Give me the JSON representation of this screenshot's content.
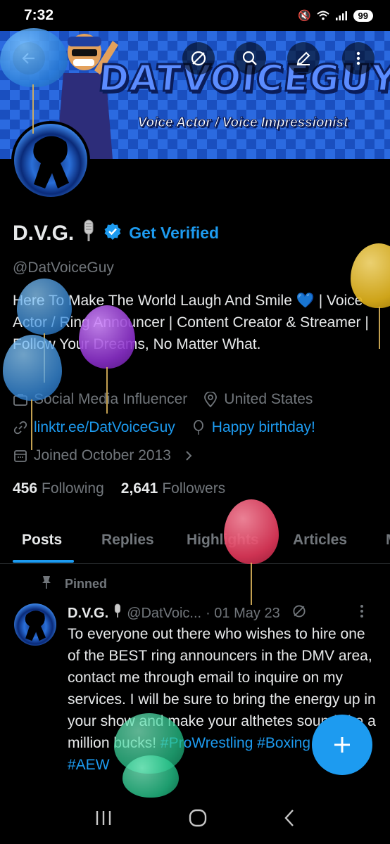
{
  "status_bar": {
    "time": "7:32",
    "battery": "99"
  },
  "profile": {
    "name": "D.V.G.",
    "get_verified": "Get Verified",
    "handle": "@DatVoiceGuy",
    "bio": "Here To Make The World Laugh And Smile 💙 | Voice Actor / Ring Announcer | Content Creator & Streamer | Follow Your Dreams, No Matter What.",
    "category": "Social Media Influencer",
    "location": "United States",
    "website": "linktr.ee/DatVoiceGuy",
    "birthday": "Happy birthday!",
    "joined": "Joined October 2013",
    "following_count": "456",
    "following_label": "Following",
    "followers_count": "2,641",
    "followers_label": "Followers"
  },
  "banner": {
    "logo_text": "DATVOICEGUY",
    "tagline": "Voice Actor / Voice Impressionist"
  },
  "tabs": [
    "Posts",
    "Replies",
    "Highlights",
    "Articles",
    "M"
  ],
  "pinned_label": "Pinned",
  "post": {
    "name": "D.V.G.",
    "handle": "@DatVoic...",
    "date": "· 01 May 23",
    "text": "To everyone out there who wishes to hire one of the BEST ring announcers in the DMV area, contact me through email to inquire on my services. I will be sure to bring the energy up in your show and make your althetes sound like a million bucks!",
    "tags": "#ProWrestling #Boxing #WWE #AEW"
  },
  "colors": {
    "accent": "#1d9bf0",
    "background": "#000000",
    "muted": "#71767b"
  }
}
